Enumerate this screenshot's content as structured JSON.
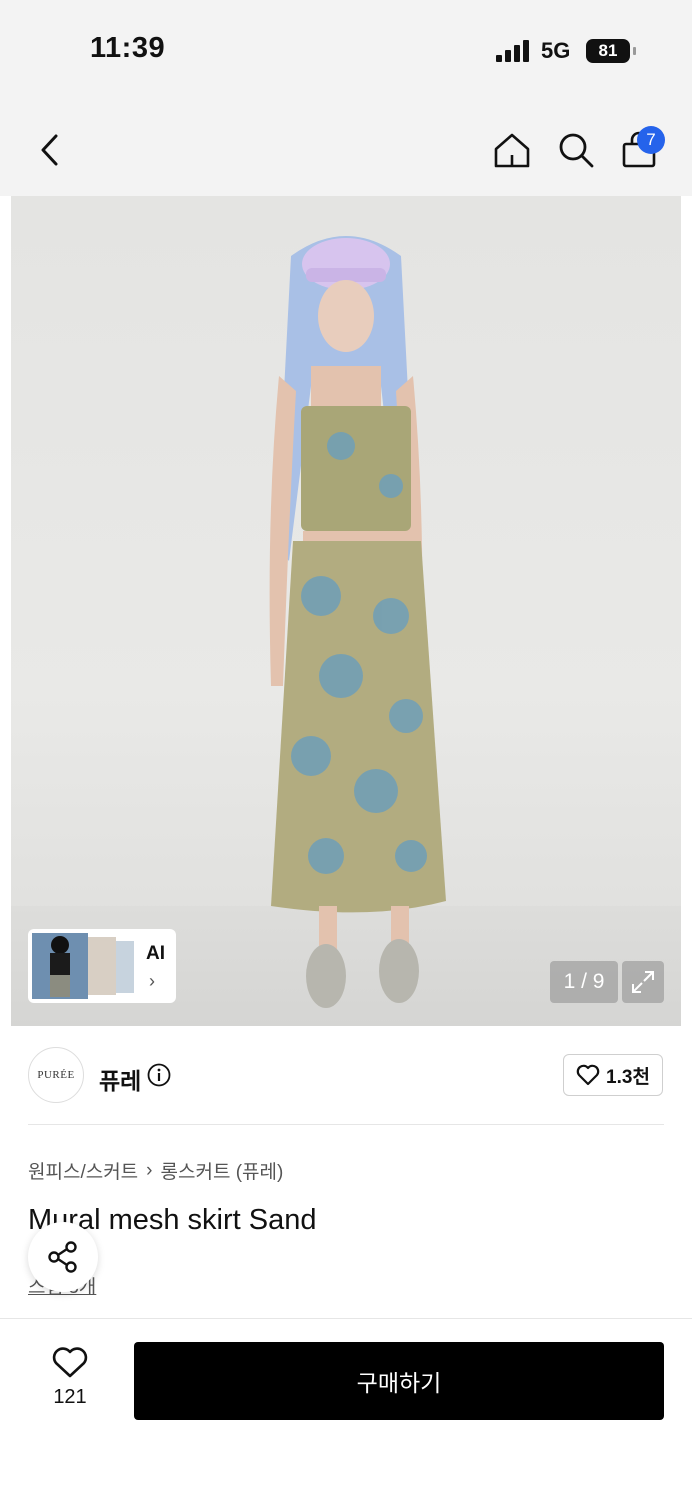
{
  "status": {
    "time": "11:39",
    "network": "5G",
    "battery": "81"
  },
  "nav": {
    "cart_badge": "7",
    "icons": [
      "back-icon",
      "home-icon",
      "search-icon",
      "cart-icon"
    ]
  },
  "gallery": {
    "ai_label": "AI",
    "pager": "1 / 9"
  },
  "brand": {
    "logo_text": "PURÉE",
    "name": "퓨레",
    "likes": "1.3천"
  },
  "product": {
    "breadcrumb": [
      "원피스/스커트",
      "롱스커트 (퓨레)"
    ],
    "title": "Mural mesh skirt Sand",
    "review_link": "스냅 3개"
  },
  "bottom": {
    "like_count": "121",
    "buy_label": "구매하기"
  },
  "colors": {
    "accent_badge": "#2563eb",
    "buy_button": "#000000"
  }
}
